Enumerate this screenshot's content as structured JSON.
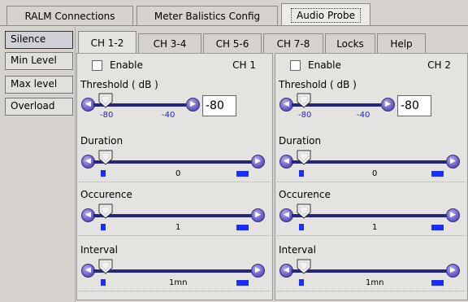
{
  "top_tabs": [
    "RALM Connections",
    "Meter Balistics Config",
    "Audio Probe"
  ],
  "side_items": [
    "Silence",
    "Min Level",
    "Max level",
    "Overload"
  ],
  "ch_tabs": [
    "CH 1-2",
    "CH 3-4",
    "CH 5-6",
    "CH 7-8",
    "Locks",
    "Help"
  ],
  "channels": [
    {
      "name": "CH 1",
      "enable_label": "Enable",
      "enabled": false,
      "threshold": {
        "label": "Threshold ( dB )",
        "min_label": "-80",
        "max_label": "-40",
        "value": "-80"
      },
      "duration": {
        "label": "Duration",
        "value": "0"
      },
      "occurence": {
        "label": "Occurence",
        "value": "1"
      },
      "interval": {
        "label": "Interval",
        "value": "1mn"
      }
    },
    {
      "name": "CH 2",
      "enable_label": "Enable",
      "enabled": false,
      "threshold": {
        "label": "Threshold ( dB )",
        "min_label": "-80",
        "max_label": "-40",
        "value": "-80"
      },
      "duration": {
        "label": "Duration",
        "value": "0"
      },
      "occurence": {
        "label": "Occurence",
        "value": "1"
      },
      "interval": {
        "label": "Interval",
        "value": "1mn"
      }
    }
  ],
  "colors": {
    "track": "#262680",
    "button": "#6f63c9",
    "marker": "#1a2fff",
    "background": "#d6d3ce"
  }
}
